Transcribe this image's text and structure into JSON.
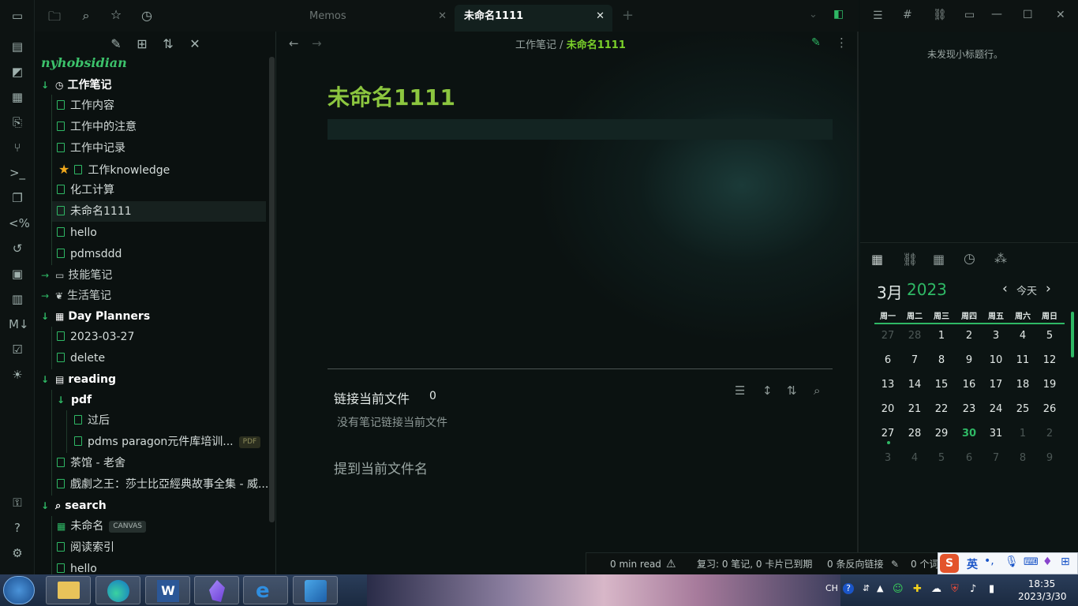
{
  "vault_name": "nyhobsidian",
  "tabs": [
    {
      "label": "Memos",
      "active": false
    },
    {
      "label": "未命名1111",
      "active": true
    }
  ],
  "breadcrumb": {
    "parent": "工作笔记",
    "sep": "/",
    "current": "未命名1111"
  },
  "note": {
    "title": "未命名1111"
  },
  "backlinks": {
    "title": "链接当前文件",
    "count": "0",
    "empty": "没有笔记链接当前文件",
    "mentions": "提到当前文件名"
  },
  "outline": {
    "empty": "未发现小标题行。"
  },
  "tree": [
    {
      "label": "工作笔记",
      "type": "folder"
    },
    {
      "label": "工作内容",
      "type": "doc"
    },
    {
      "label": "工作中的注意",
      "type": "doc"
    },
    {
      "label": "工作中记录",
      "type": "doc"
    },
    {
      "label": "工作knowledge",
      "type": "doc",
      "starred": true
    },
    {
      "label": "化工计算",
      "type": "doc"
    },
    {
      "label": "未命名1111",
      "type": "doc",
      "selected": true
    },
    {
      "label": "hello",
      "type": "doc"
    },
    {
      "label": "pdmsddd",
      "type": "doc"
    },
    {
      "label": "技能笔记",
      "type": "folder-collapsed"
    },
    {
      "label": "生活笔记",
      "type": "folder-collapsed"
    },
    {
      "label": "Day Planners",
      "type": "folder"
    },
    {
      "label": "2023-03-27",
      "type": "doc"
    },
    {
      "label": "delete",
      "type": "doc"
    },
    {
      "label": "reading",
      "type": "folder"
    },
    {
      "label": "pdf",
      "type": "folder"
    },
    {
      "label": "过后",
      "type": "doc"
    },
    {
      "label": "pdms paragon元件库培训...",
      "type": "doc",
      "badge": "PDF"
    },
    {
      "label": "茶馆 - 老舍",
      "type": "doc"
    },
    {
      "label": "戲劇之王：莎士比亞經典故事全集 - 威...",
      "type": "doc"
    },
    {
      "label": "search",
      "type": "folder"
    },
    {
      "label": "未命名",
      "type": "canvas",
      "badge": "CANVAS"
    },
    {
      "label": "阅读索引",
      "type": "doc"
    },
    {
      "label": "hello",
      "type": "doc"
    }
  ],
  "calendar": {
    "month": "3月",
    "year": "2023",
    "today_label": "今天",
    "weekdays": [
      "周一",
      "周二",
      "周三",
      "周四",
      "周五",
      "周六",
      "周日"
    ],
    "weeks": [
      [
        "27",
        "28",
        "1",
        "2",
        "3",
        "4",
        "5"
      ],
      [
        "6",
        "7",
        "8",
        "9",
        "10",
        "11",
        "12"
      ],
      [
        "13",
        "14",
        "15",
        "16",
        "17",
        "18",
        "19"
      ],
      [
        "20",
        "21",
        "22",
        "23",
        "24",
        "25",
        "26"
      ],
      [
        "27",
        "28",
        "29",
        "30",
        "31",
        "1",
        "2"
      ],
      [
        "3",
        "4",
        "5",
        "6",
        "7",
        "8",
        "9"
      ]
    ],
    "today": "30"
  },
  "status": {
    "read": "0 min read",
    "review": "复习: 0 笔记, 0 卡片已到期",
    "backlinks": "0 条反向链接",
    "words": "0 个词"
  },
  "ime": {
    "lang": "英"
  },
  "taskbar": {
    "lang": "CH",
    "time": "18:35",
    "date": "2023/3/30"
  },
  "colors": {
    "accent": "#2fb865",
    "title": "#8cc63f",
    "link": "#7bd12a"
  }
}
